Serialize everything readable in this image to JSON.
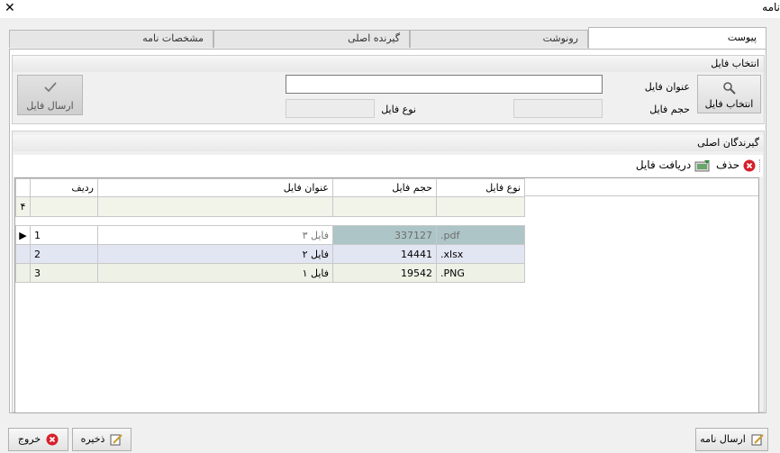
{
  "window": {
    "title": "نامه",
    "close": "✕"
  },
  "tabs": [
    "پیوست",
    "رونوشت",
    "گیرنده اصلی",
    "مشخصات نامه"
  ],
  "file_group": {
    "header": "انتخاب فایل",
    "select_button": "انتخاب فایل",
    "title_label": "عنوان فایل",
    "title_value": "",
    "size_label": "حجم فایل",
    "size_value": "",
    "type_label": "نوع فایل",
    "type_value": "",
    "send_button": "ارسال فایل"
  },
  "recipients_group": {
    "header": "گیرندگان اصلی",
    "delete_label": "حذف",
    "download_label": "دریافت فایل"
  },
  "grid": {
    "columns": [
      "ردیف",
      "عنوان فایل",
      "حجم فایل",
      "نوع فایل"
    ],
    "filter_row_icon": "۴",
    "rows": [
      {
        "row": "1",
        "title": "فایل ۳",
        "size": "337127",
        "type": ".pdf"
      },
      {
        "row": "2",
        "title": "فایل ۲",
        "size": "14441",
        "type": ".xlsx"
      },
      {
        "row": "3",
        "title": "فایل ۱",
        "size": "19542",
        "type": ".PNG"
      }
    ]
  },
  "footer": {
    "send_letter": "ارسال نامه",
    "save": "ذخیره",
    "exit": "خروج"
  },
  "colors": {
    "selected_row": "#adc5c6",
    "alt_row": "#e2e6f3",
    "normal_row": "#eef1e5",
    "delete_icon": "#d6202a"
  }
}
